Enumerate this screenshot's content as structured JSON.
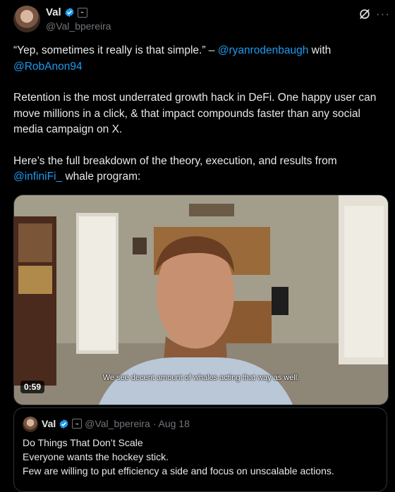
{
  "author": {
    "name": "Val",
    "handle": "@Val_bpereira",
    "affiliate_icon": "affiliate-badge-icon",
    "verified_color": "#1d9bf0"
  },
  "tweet": {
    "line1_quote": "“Yep, sometimes it really is that simple.” – ",
    "line1_mention": "@ryanrodenbaugh",
    "line1_with": " with",
    "line2_mention": "@RobAnon94",
    "para2": "Retention is the most underrated growth hack in DeFi. One happy user can move millions in a click, & that impact compounds faster than any social media campaign on X.",
    "para3_text": "Here’s the full breakdown of the theory, execution, and results from ",
    "para3_mention": "@infiniFi_",
    "para3_tail": " whale program:"
  },
  "video": {
    "caption": "We see decent amount of whales acting that way as well.",
    "duration": "0:59"
  },
  "quote": {
    "name": "Val",
    "handle_date": "@Val_bpereira · Aug 18",
    "lines": [
      "Do Things That Don’t Scale",
      "Everyone wants the hockey stick.",
      "Few are willing to put efficiency a side and focus on unscalable actions."
    ]
  },
  "colors": {
    "link": "#1d9bf0",
    "muted": "#71767b",
    "text": "#e7e9ea",
    "background": "#000000"
  },
  "icons": [
    "grok-icon",
    "more-icon",
    "verified-badge-icon",
    "affiliate-badge-icon"
  ]
}
